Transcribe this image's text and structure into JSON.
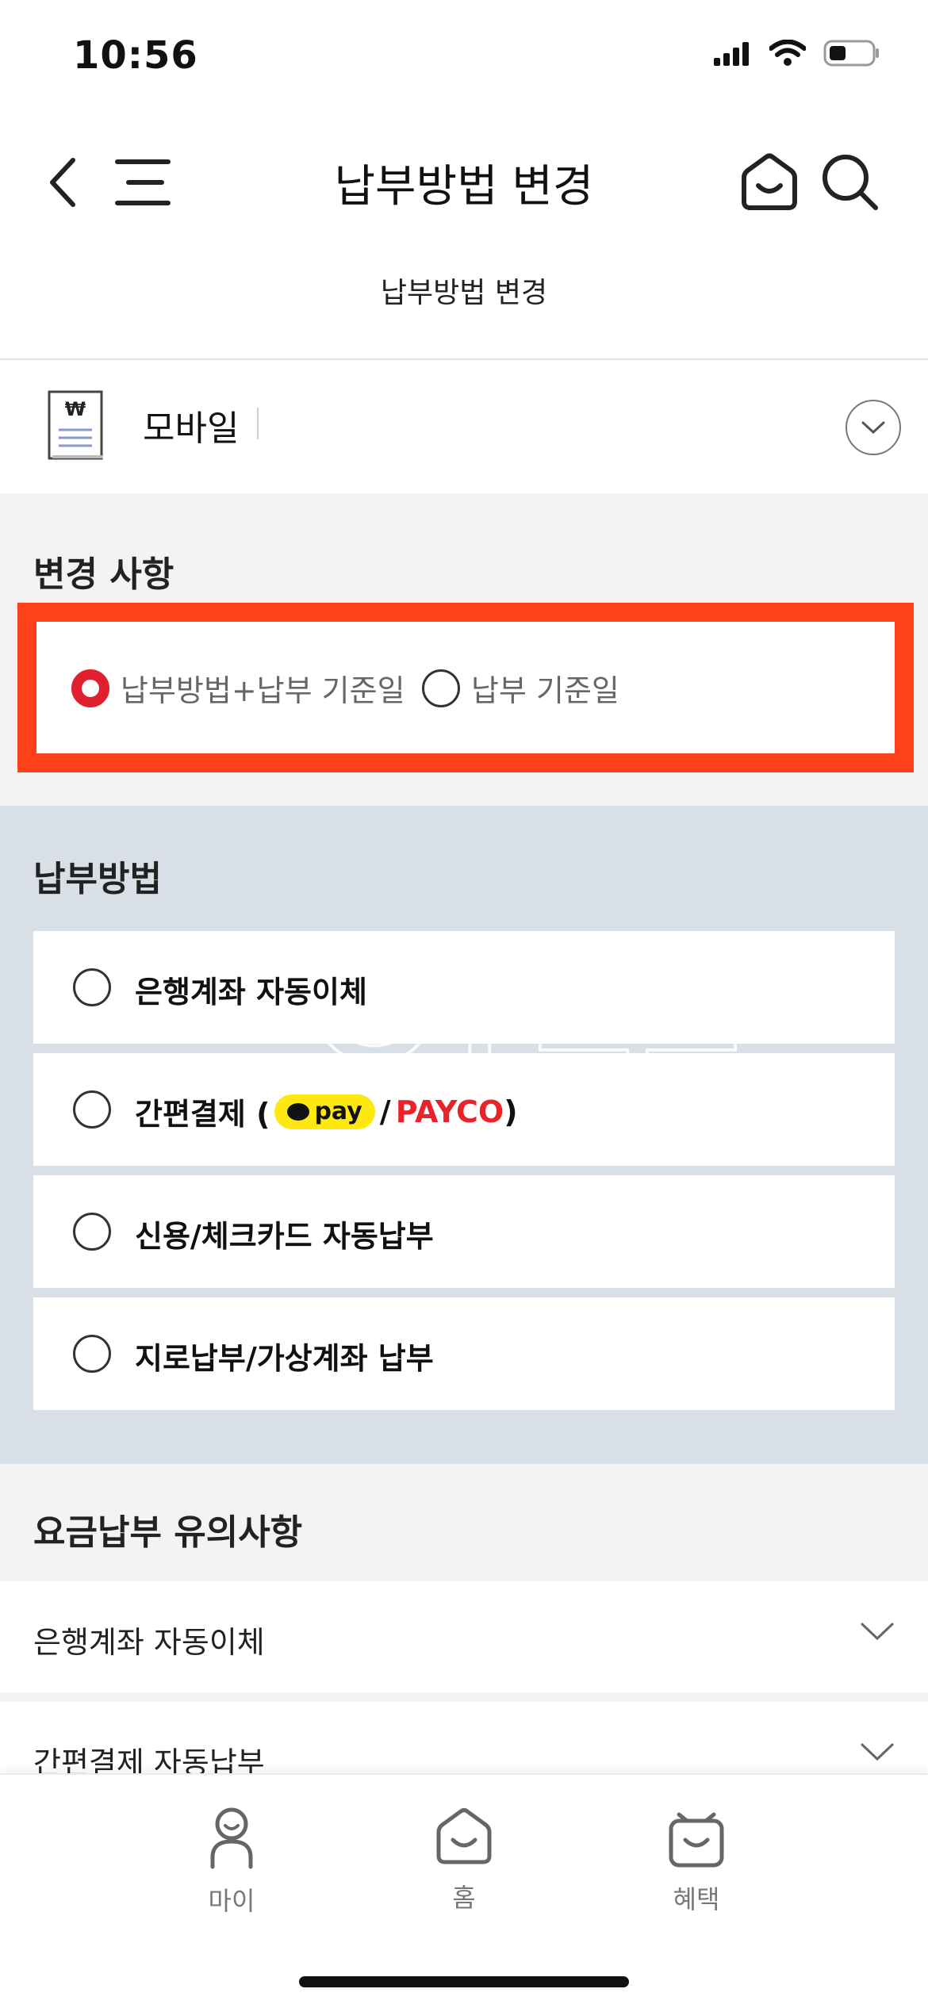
{
  "status_bar": {
    "time": "10:56"
  },
  "header": {
    "title": "납부방법 변경"
  },
  "subtitle": "납부방법 변경",
  "account": {
    "label": "모바일"
  },
  "change_section": {
    "title": "변경 사항",
    "options": [
      {
        "label": "납부방법+납부 기준일",
        "selected": true
      },
      {
        "label": "납부 기준일",
        "selected": false
      }
    ]
  },
  "payment_section": {
    "title": "납부방법",
    "watermark": "익궁",
    "methods": [
      {
        "label": "은행계좌 자동이체"
      },
      {
        "label_prefix": "간편결제 (",
        "kakao": "pay",
        "slash": " / ",
        "payco": "PAYCO",
        "label_suffix": ")"
      },
      {
        "label": "신용/체크카드 자동납부"
      },
      {
        "label": "지로납부/가상계좌 납부"
      }
    ]
  },
  "notes_section": {
    "title": "요금납부 유의사항",
    "items": [
      {
        "label": "은행계좌 자동이체"
      },
      {
        "label": "간편결제 자동납부"
      }
    ]
  },
  "tab_bar": {
    "tabs": [
      {
        "label": "마이",
        "icon": "person-icon"
      },
      {
        "label": "홈",
        "icon": "home-icon"
      },
      {
        "label": "혜택",
        "icon": "gift-icon"
      }
    ]
  },
  "colors": {
    "highlight": "#ff4119",
    "radio_selected": "#e0202e",
    "pay_bg": "#d9dfe7",
    "kakao": "#ffe812",
    "payco": "#e8232a"
  }
}
